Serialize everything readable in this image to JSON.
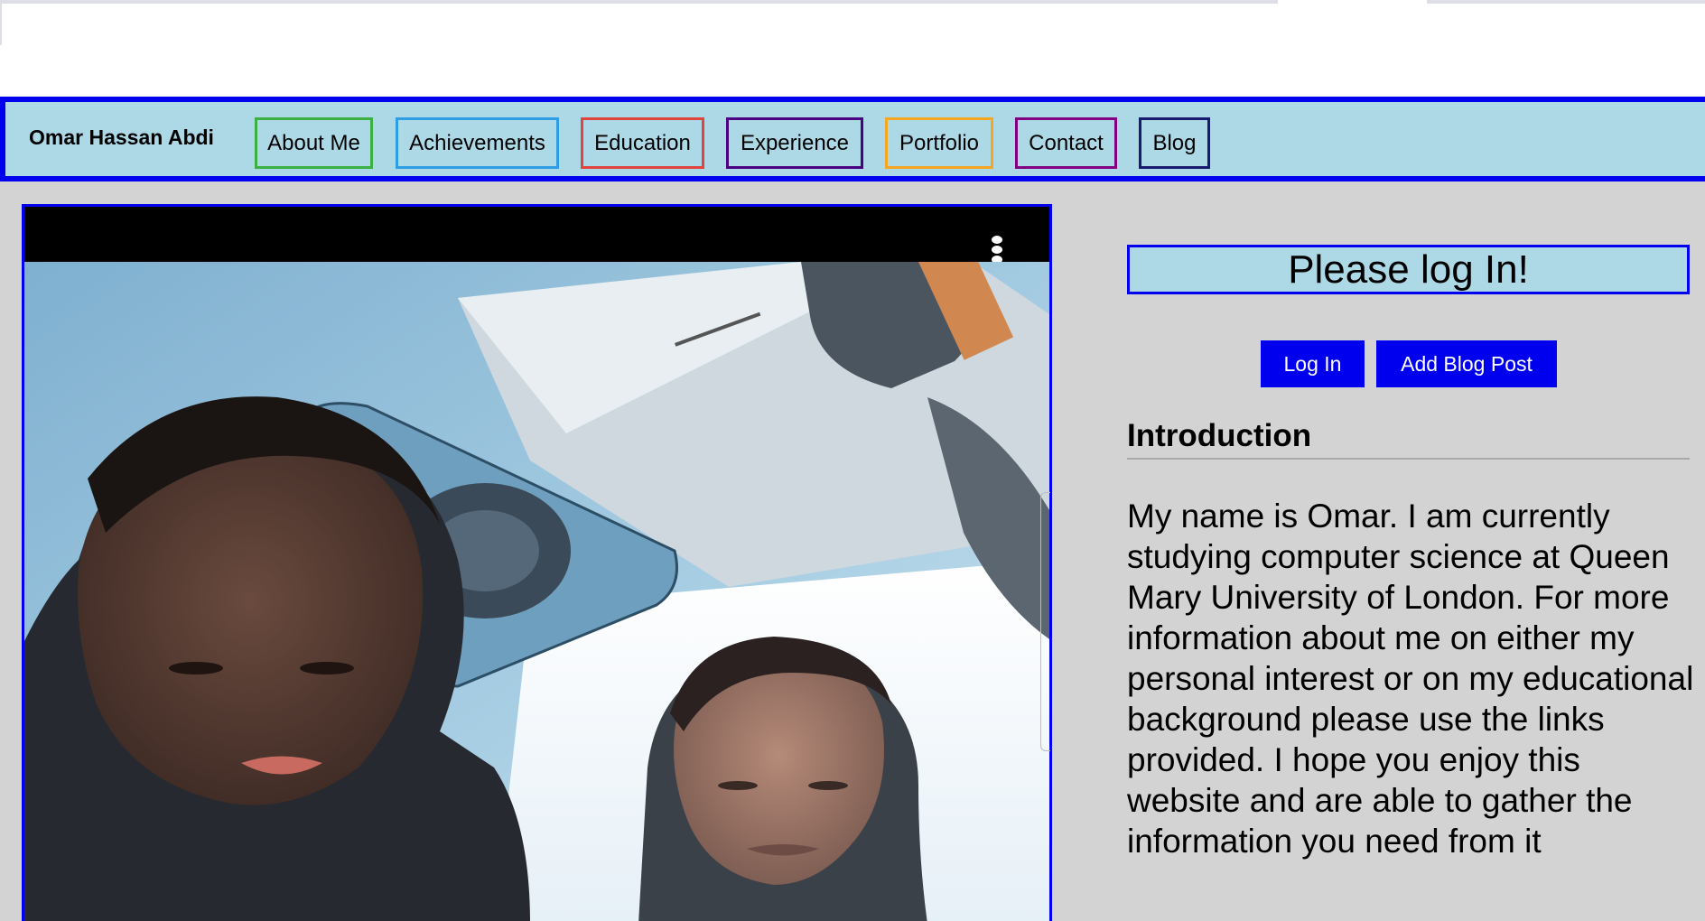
{
  "navbar": {
    "brand": "Omar Hassan Abdi",
    "items": [
      {
        "label": "About Me",
        "color": "#3cb043"
      },
      {
        "label": "Achievements",
        "color": "#2f9de4"
      },
      {
        "label": "Education",
        "color": "#e0443c"
      },
      {
        "label": "Experience",
        "color": "#4b0082"
      },
      {
        "label": "Portfolio",
        "color": "#f5a623"
      },
      {
        "label": "Contact",
        "color": "#800080"
      },
      {
        "label": "Blog",
        "color": "#191970"
      }
    ]
  },
  "media": {
    "menu_icon": "vertical-ellipsis-icon",
    "photo_description_icon": "photo"
  },
  "sidebar": {
    "login_message": "Please log In!",
    "login_button": "Log In",
    "add_post_button": "Add Blog Post",
    "intro_heading": "Introduction",
    "intro_text": "My name is Omar. I am currently studying computer science at Queen Mary University of London. For more information about me on either my personal interest or on my educational background please use the links provided. I hope you enjoy this website and are able to gather the information you need from it"
  },
  "colors": {
    "accent": "#0000ee",
    "nav_background": "#add8e6",
    "page_background": "#d3d3d3"
  }
}
